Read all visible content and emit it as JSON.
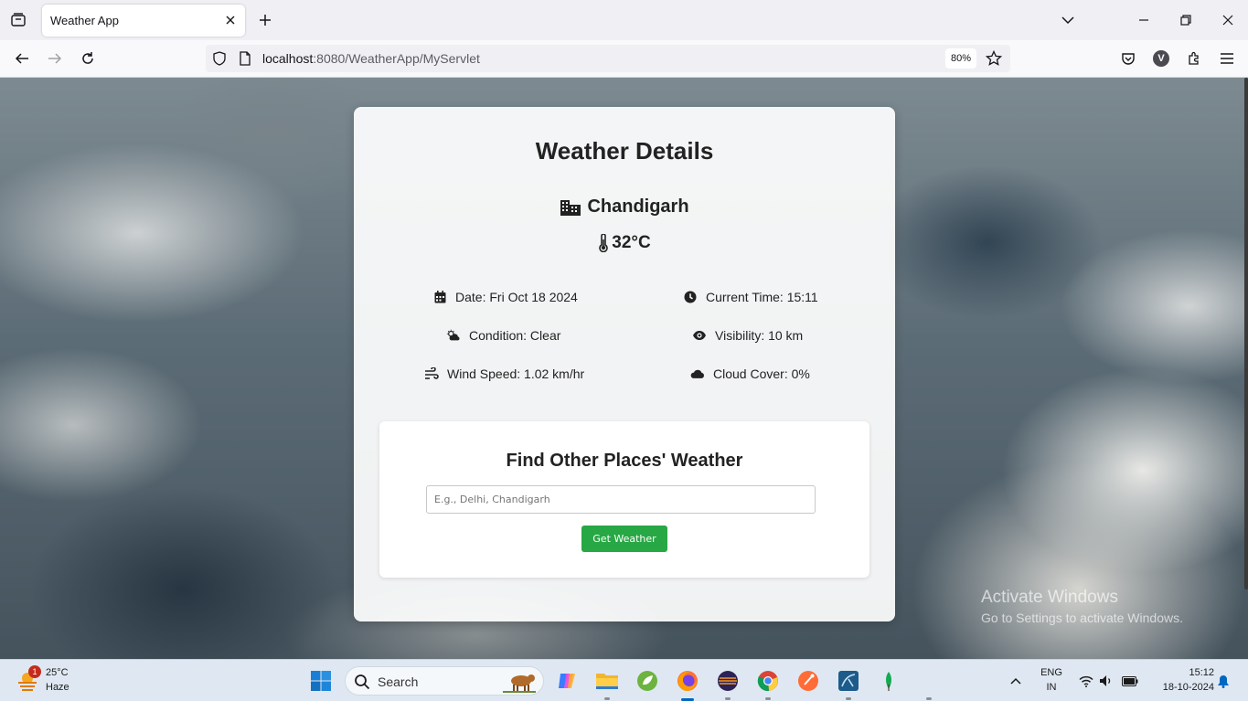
{
  "browser": {
    "tab_title": "Weather App",
    "url_host": "localhost",
    "url_rest": ":8080/WeatherApp/MyServlet",
    "zoom": "80%",
    "profile_initial": "V"
  },
  "weather": {
    "heading": "Weather Details",
    "city": "Chandigarh",
    "temperature": "32°C",
    "date_label": "Date: Fri Oct 18 2024",
    "time_label": "Current Time: 15:11",
    "condition_label": "Condition: Clear",
    "visibility_label": "Visibility: 10 km",
    "wind_label": "Wind Speed: 1.02 km/hr",
    "cloud_label": "Cloud Cover: 0%"
  },
  "search": {
    "heading": "Find Other Places' Weather",
    "placeholder": "E.g., Delhi, Chandigarh",
    "value": "",
    "button_label": "Get Weather"
  },
  "watermark": {
    "line1": "Activate Windows",
    "line2": "Go to Settings to activate Windows."
  },
  "taskbar": {
    "weather_badge": "1",
    "weather_temp": "25°C",
    "weather_condition": "Haze",
    "search_label": "Search",
    "language_top": "ENG",
    "language_bottom": "IN",
    "clock_time": "15:12",
    "clock_date": "18-10-2024"
  },
  "colors": {
    "accent_button": "#28a745",
    "windows_blue": "#0067c0"
  }
}
